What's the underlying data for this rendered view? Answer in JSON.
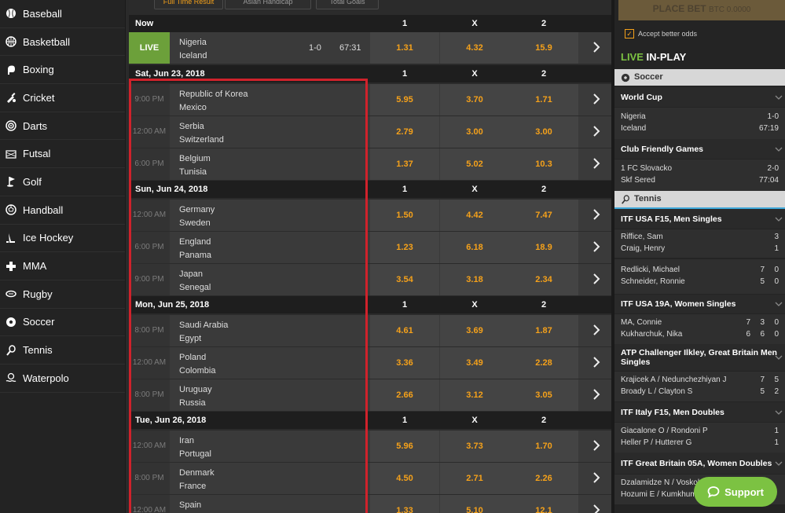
{
  "sidebar": {
    "items": [
      {
        "label": "Baseball",
        "icon": "baseball-icon"
      },
      {
        "label": "Basketball",
        "icon": "basketball-icon"
      },
      {
        "label": "Boxing",
        "icon": "boxing-glove-icon"
      },
      {
        "label": "Cricket",
        "icon": "cricket-icon"
      },
      {
        "label": "Darts",
        "icon": "darts-icon"
      },
      {
        "label": "Futsal",
        "icon": "futsal-icon"
      },
      {
        "label": "Golf",
        "icon": "golf-icon"
      },
      {
        "label": "Handball",
        "icon": "handball-icon"
      },
      {
        "label": "Ice Hockey",
        "icon": "ice-hockey-icon"
      },
      {
        "label": "MMA",
        "icon": "mma-icon"
      },
      {
        "label": "Rugby",
        "icon": "rugby-icon"
      },
      {
        "label": "Soccer",
        "icon": "soccer-icon"
      },
      {
        "label": "Tennis",
        "icon": "tennis-icon"
      },
      {
        "label": "Waterpolo",
        "icon": "waterpolo-icon"
      }
    ]
  },
  "main": {
    "tabs": [
      "Full Time Result",
      "Asian Handicap",
      "Total Goals"
    ],
    "col1": "1",
    "colx": "X",
    "col2": "2",
    "now_label": "Now",
    "live_event": {
      "badge": "LIVE",
      "home": "Nigeria",
      "away": "Iceland",
      "score": "1-0",
      "clock": "67:31",
      "o1": "1.31",
      "ox": "4.32",
      "o2": "15.9"
    },
    "days": [
      {
        "label": "Sat, Jun 23, 2018",
        "events": [
          {
            "time": "9:00 PM",
            "home": "Republic of Korea",
            "away": "Mexico",
            "o1": "5.95",
            "ox": "3.70",
            "o2": "1.71"
          },
          {
            "time": "12:00 AM",
            "home": "Serbia",
            "away": "Switzerland",
            "o1": "2.79",
            "ox": "3.00",
            "o2": "3.00"
          },
          {
            "time": "6:00 PM",
            "home": "Belgium",
            "away": "Tunisia",
            "o1": "1.37",
            "ox": "5.02",
            "o2": "10.3"
          }
        ]
      },
      {
        "label": "Sun, Jun 24, 2018",
        "events": [
          {
            "time": "12:00 AM",
            "home": "Germany",
            "away": "Sweden",
            "o1": "1.50",
            "ox": "4.42",
            "o2": "7.47"
          },
          {
            "time": "6:00 PM",
            "home": "England",
            "away": "Panama",
            "o1": "1.23",
            "ox": "6.18",
            "o2": "18.9"
          },
          {
            "time": "9:00 PM",
            "home": "Japan",
            "away": "Senegal",
            "o1": "3.54",
            "ox": "3.18",
            "o2": "2.34"
          }
        ]
      },
      {
        "label": "Mon, Jun 25, 2018",
        "events": [
          {
            "time": "8:00 PM",
            "home": "Saudi Arabia",
            "away": "Egypt",
            "o1": "4.61",
            "ox": "3.69",
            "o2": "1.87"
          },
          {
            "time": "12:00 AM",
            "home": "Poland",
            "away": "Colombia",
            "o1": "3.36",
            "ox": "3.49",
            "o2": "2.28"
          },
          {
            "time": "8:00 PM",
            "home": "Uruguay",
            "away": "Russia",
            "o1": "2.66",
            "ox": "3.12",
            "o2": "3.05"
          }
        ]
      },
      {
        "label": "Tue, Jun 26, 2018",
        "events": [
          {
            "time": "12:00 AM",
            "home": "Iran",
            "away": "Portugal",
            "o1": "5.96",
            "ox": "3.73",
            "o2": "1.70"
          },
          {
            "time": "8:00 PM",
            "home": "Denmark",
            "away": "France",
            "o1": "4.50",
            "ox": "2.71",
            "o2": "2.26"
          },
          {
            "time": "12:00 AM",
            "home": "Spain",
            "away": "",
            "o1": "1.33",
            "ox": "5.10",
            "o2": "12.1"
          }
        ]
      }
    ]
  },
  "right": {
    "place_bet": "PLACE BET",
    "place_bet_amount": "BTC 0.0000",
    "accept_label": "Accept better odds",
    "live_word": "LIVE",
    "inplay_word": "IN-PLAY",
    "soccer_label": "Soccer",
    "tennis_label": "Tennis",
    "soccer_comps": [
      {
        "name": "World Cup",
        "home": "Nigeria",
        "away": "Iceland",
        "s1": "1-0",
        "s2": "67:19"
      },
      {
        "name": "Club Friendly Games",
        "home": "1 FC Slovacko",
        "away": "Skf Sered",
        "s1": "2-0",
        "s2": "77:04"
      }
    ],
    "tennis_comps": [
      {
        "name": "ITF USA F15, Men Singles",
        "matches": [
          {
            "p1": "Riffice, Sam",
            "p2": "Craig, Henry",
            "sc1": [
              "3"
            ],
            "sc2": [
              "1"
            ]
          },
          {
            "p1": "Redlicki, Michael",
            "p2": "Schneider, Ronnie",
            "sc1": [
              "7",
              "0"
            ],
            "sc2": [
              "5",
              "0"
            ]
          }
        ]
      },
      {
        "name": "ITF USA 19A, Women Singles",
        "matches": [
          {
            "p1": "MA, Connie",
            "p2": "Kukharchuk, Nika",
            "sc1": [
              "7",
              "3",
              "0"
            ],
            "sc2": [
              "6",
              "6",
              "0"
            ]
          }
        ]
      },
      {
        "name": "ATP Challenger Ilkley, Great Britain Men Singles",
        "matches": [
          {
            "p1": "Krajicek A / Nedunchezhiyan J",
            "p2": "Broady L / Clayton S",
            "sc1": [
              "7",
              "5"
            ],
            "sc2": [
              "5",
              "2"
            ]
          }
        ]
      },
      {
        "name": "ITF Italy F15, Men Doubles",
        "matches": [
          {
            "p1": "Giacalone O / Rondoni P",
            "p2": "Heller P / Hutterer G",
            "sc1": [
              "1"
            ],
            "sc2": [
              "1"
            ]
          }
        ]
      },
      {
        "name": "ITF Great Britain 05A, Women Doubles",
        "matches": [
          {
            "p1": "Dzalamidze N / Voskob",
            "p2": "Hozumi E / Kumkhum",
            "sc1": [],
            "sc2": []
          }
        ]
      }
    ],
    "support_label": "Support"
  },
  "colors": {
    "accent": "#f5a11a",
    "live_green": "#6ca03a",
    "highlight_red": "#d0222b",
    "tennis_blue": "#3ea7d8"
  }
}
